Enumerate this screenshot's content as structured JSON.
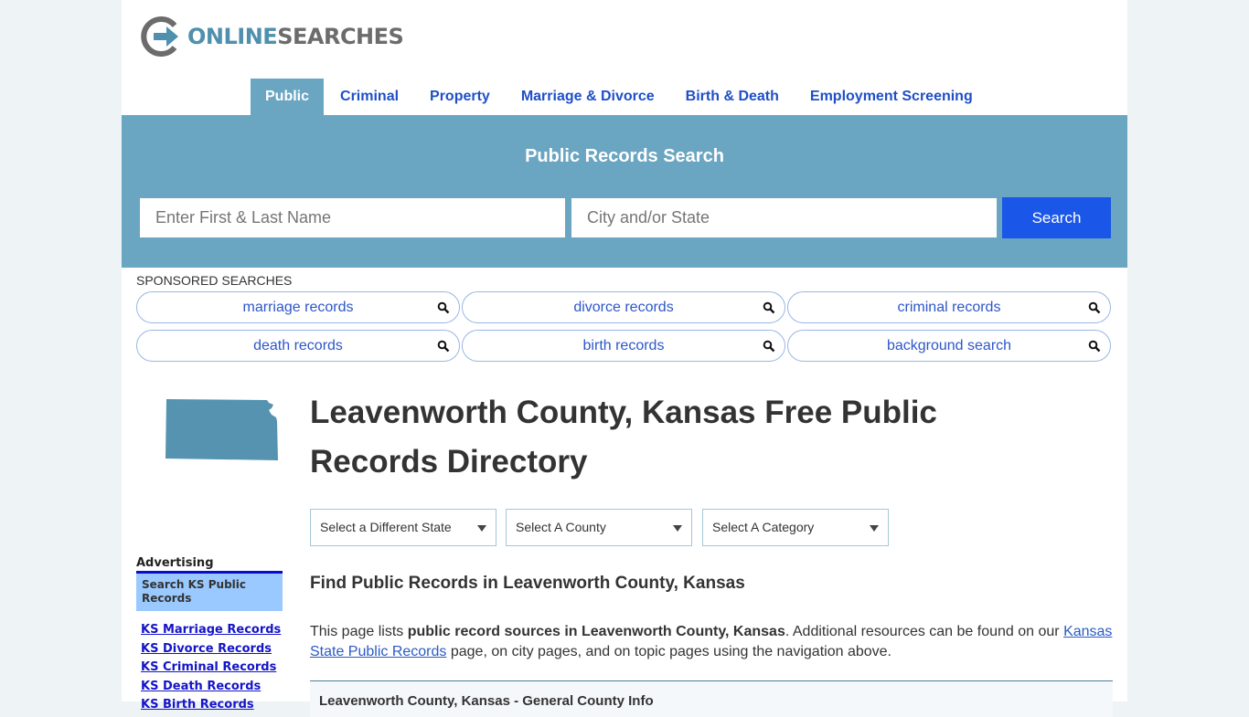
{
  "logo": {
    "part1": "ONLINE",
    "part2": "SEARCHES",
    "colors": {
      "accent": "#4f90ae",
      "gray": "#6c6c6c"
    }
  },
  "nav": {
    "items": [
      {
        "label": "Public",
        "active": true
      },
      {
        "label": "Criminal",
        "active": false
      },
      {
        "label": "Property",
        "active": false
      },
      {
        "label": "Marriage & Divorce",
        "active": false
      },
      {
        "label": "Birth & Death",
        "active": false
      },
      {
        "label": "Employment Screening",
        "active": false
      }
    ]
  },
  "search": {
    "title": "Public Records Search",
    "name_placeholder": "Enter First & Last Name",
    "name_value": "",
    "location_placeholder": "City and/or State",
    "location_value": "",
    "button_label": "Search",
    "band_color": "#6aa5c1",
    "button_color": "#1a56e8"
  },
  "sponsored": {
    "label": "SPONSORED SEARCHES",
    "items": [
      {
        "label": "marriage records",
        "icon": "search-icon"
      },
      {
        "label": "divorce records",
        "icon": "search-icon"
      },
      {
        "label": "criminal records",
        "icon": "search-icon"
      },
      {
        "label": "death records",
        "icon": "search-icon"
      },
      {
        "label": "birth records",
        "icon": "search-icon"
      },
      {
        "label": "background search",
        "icon": "search-icon"
      }
    ]
  },
  "main": {
    "title": "Leavenworth County, Kansas Free Public Records Directory",
    "selects": {
      "state": "Select a Different State",
      "county": "Select A County",
      "category": "Select A Category"
    },
    "section_heading": "Find Public Records in Leavenworth County, Kansas",
    "intro": {
      "text1": "This page lists ",
      "bold": "public record sources in Leavenworth County, Kansas",
      "text2": ". Additional resources can be found on our ",
      "link": "Kansas State Public Records",
      "text3": " page, on city pages, and on topic pages using the navigation above."
    },
    "info_panel_title": "Leavenworth County, Kansas - General County Info"
  },
  "sidebar": {
    "state_shape": "kansas-map",
    "advertising_label": "Advertising",
    "ad_box": "Search KS Public Records",
    "links": [
      "KS Marriage Records",
      "KS Divorce Records",
      "KS Criminal Records",
      "KS Death Records",
      "KS Birth Records"
    ]
  }
}
